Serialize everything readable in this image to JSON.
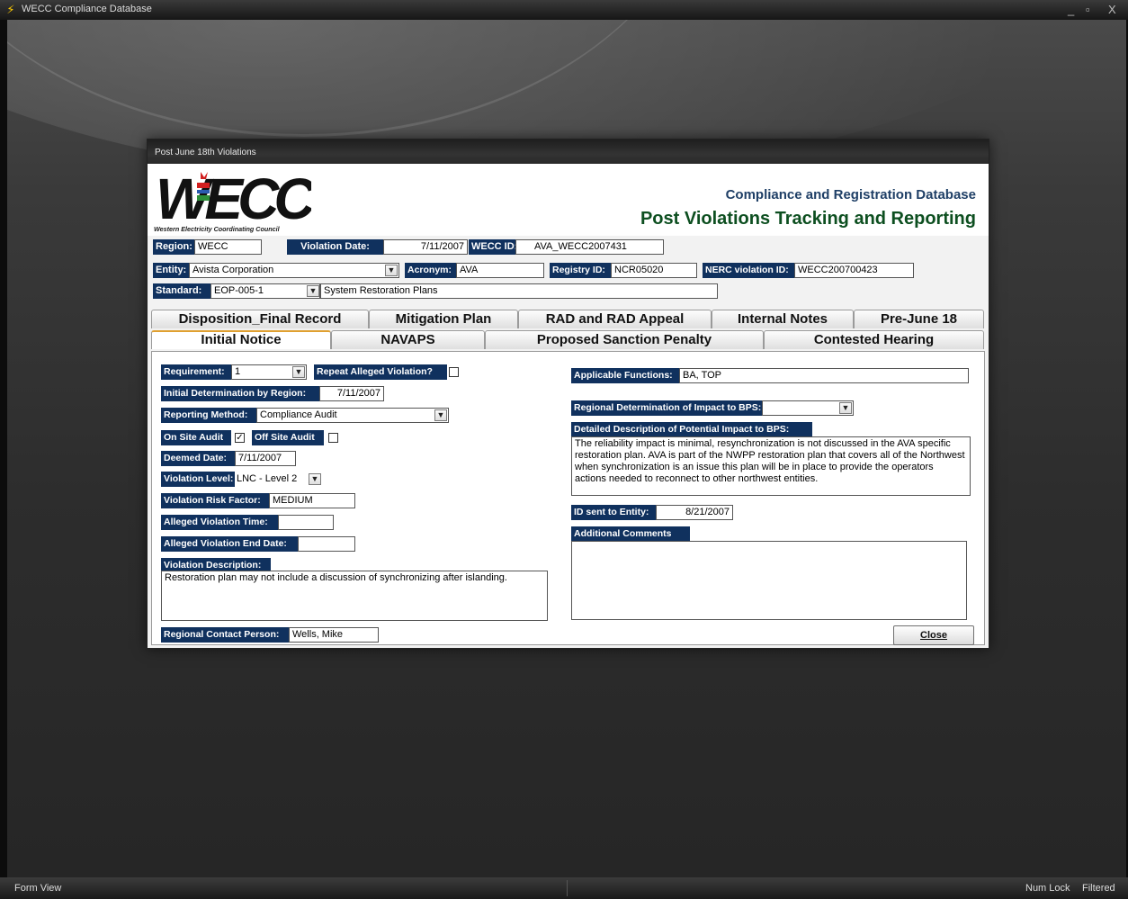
{
  "app": {
    "title": "WECC Compliance Database",
    "min": "_",
    "restore": "▫",
    "close": "X"
  },
  "statusbar": {
    "left": "Form View",
    "num_lock": "Num Lock",
    "filtered": "Filtered"
  },
  "form": {
    "title": "Post June 18th Violations",
    "logo_text": "WECC",
    "logo_tagline": "Western Electricity Coordinating Council",
    "subtitle": "Compliance and Registration Database",
    "main_title": "Post Violations Tracking and Reporting"
  },
  "header_fields": {
    "region_label": "Region:",
    "region_value": "WECC",
    "violation_date_label": "Violation Date:",
    "violation_date_value": "7/11/2007",
    "wecc_id_label": "WECC ID:",
    "wecc_id_value": "AVA_WECC2007431",
    "entity_label": "Entity:",
    "entity_value": "Avista Corporation",
    "acronym_label": "Acronym:",
    "acronym_value": "AVA",
    "registry_id_label": "Registry ID:",
    "registry_id_value": "NCR05020",
    "nerc_label": "NERC violation ID:",
    "nerc_value": "WECC200700423",
    "standard_label": "Standard:",
    "standard_value": "EOP-005-1",
    "standard_desc": "System Restoration Plans"
  },
  "tabs_row1": [
    "Disposition_Final Record",
    "Mitigation Plan",
    "RAD and RAD Appeal",
    "Internal Notes",
    "Pre-June 18"
  ],
  "tabs_row2": [
    "Initial Notice",
    "NAVAPS",
    "Proposed Sanction Penalty",
    "Contested Hearing"
  ],
  "initial_notice": {
    "requirement_label": "Requirement:",
    "requirement_value": "1",
    "repeat_label": "Repeat Alleged Violation?",
    "initial_det_label": "Initial Determination by Region:",
    "initial_det_value": "7/11/2007",
    "reporting_label": "Reporting Method:",
    "reporting_value": "Compliance Audit",
    "onsite_label": "On Site Audit",
    "onsite_check": "✓",
    "offsite_label": "Off Site Audit",
    "offsite_check": "",
    "deemed_label": "Deemed Date:",
    "deemed_value": "7/11/2007",
    "level_label": "Violation Level:",
    "level_value": "LNC - Level 2",
    "risk_label": "Violation Risk Factor:",
    "risk_value": "MEDIUM",
    "alleged_time_label": "Alleged Violation Time:",
    "alleged_time_value": "",
    "alleged_end_label": "Alleged Violation End Date:",
    "alleged_end_value": "",
    "desc_label": "Violation Description:",
    "desc_value": "Restoration plan may not include a discussion of synchronizing after islanding.",
    "contact_label": "Regional Contact Person:",
    "contact_value": "Wells, Mike",
    "applicable_label": "Applicable Functions:",
    "applicable_value": "BA, TOP",
    "regional_impact_label": "Regional Determination of Impact to BPS:",
    "regional_impact_value": "",
    "detailed_label": "Detailed Description of Potential Impact to BPS:",
    "detailed_value": "The reliability impact is minimal, resynchronization is not discussed in the AVA specific restoration plan. AVA is part of the NWPP restoration plan that covers all of the Northwest when synchronization is an issue this plan will be in place to provide the operators actions needed to reconnect to other northwest entities.",
    "id_sent_label": "ID sent to Entity:",
    "id_sent_value": "8/21/2007",
    "additional_label": "Additional Comments",
    "additional_value": "",
    "close_button": "Close"
  }
}
